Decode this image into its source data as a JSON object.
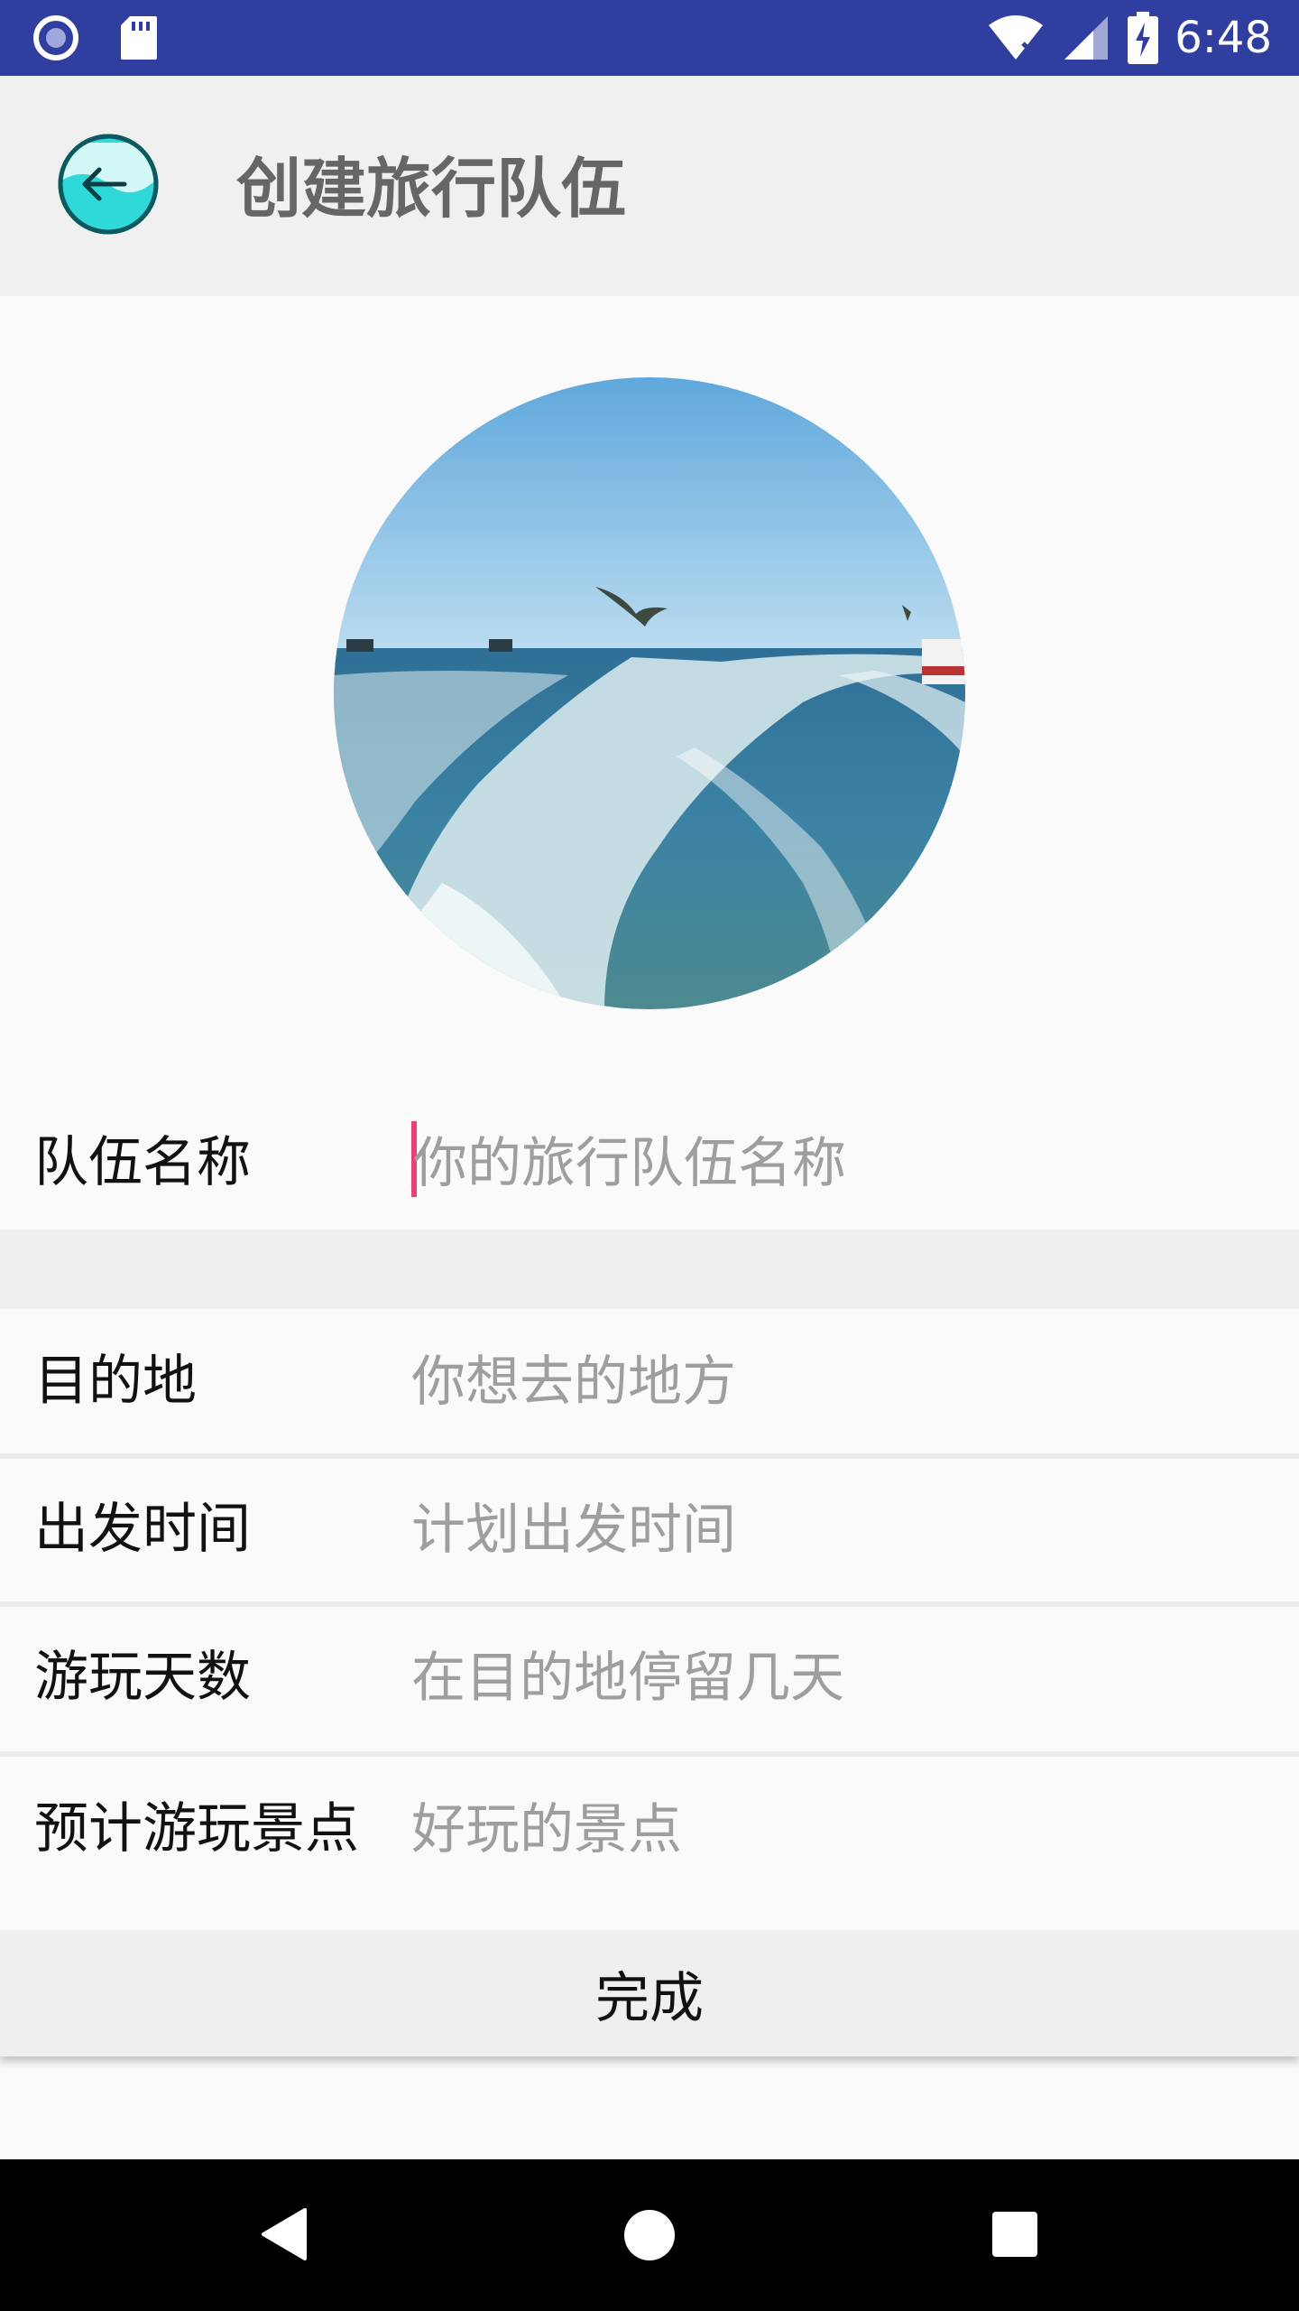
{
  "status_bar": {
    "time": "6:48",
    "icons": [
      "record-icon",
      "sd-card-icon",
      "wifi-off-icon",
      "cell-signal-icon",
      "battery-charging-icon"
    ]
  },
  "app_bar": {
    "title": "创建旅行队伍",
    "back_icon": "back-arrow-icon"
  },
  "avatar": {
    "image": "sea-wake-photo"
  },
  "form": {
    "team_name": {
      "label": "队伍名称",
      "placeholder": "你的旅行队伍名称",
      "value": ""
    },
    "destination": {
      "label": "目的地",
      "placeholder": "你想去的地方",
      "value": ""
    },
    "departure_time": {
      "label": "出发时间",
      "placeholder": "计划出发时间",
      "value": ""
    },
    "days": {
      "label": "游玩天数",
      "placeholder": "在目的地停留几天",
      "value": ""
    },
    "attractions": {
      "label": "预计游玩景点",
      "placeholder": "好玩的景点",
      "value": ""
    }
  },
  "actions": {
    "done_label": "完成"
  },
  "nav_bar": {
    "icons": [
      "back-triangle-icon",
      "home-circle-icon",
      "recents-square-icon"
    ]
  },
  "colors": {
    "status_bar": "#303f9f",
    "cursor": "#e8407b",
    "placeholder": "#9e9e9e"
  }
}
